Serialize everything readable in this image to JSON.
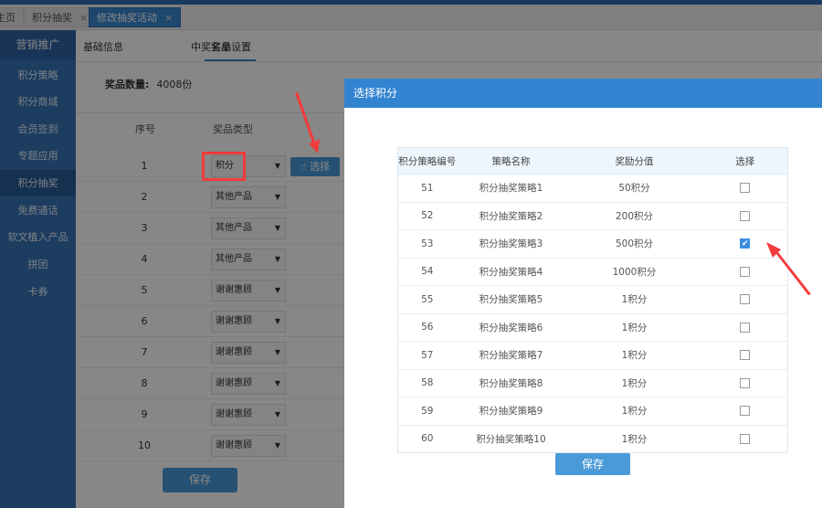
{
  "tabs": [
    {
      "label": "主页",
      "closable": false
    },
    {
      "label": "积分抽奖",
      "closable": true
    },
    {
      "label": "修改抽奖活动",
      "closable": true,
      "active": true
    }
  ],
  "close_glyph": "×",
  "sidebar": {
    "header": "营销推广",
    "items": [
      "积分策略",
      "积分商城",
      "会员签到",
      "专题应用",
      "积分抽奖",
      "免费通话",
      "软文植入产品",
      "拼团",
      "卡券"
    ],
    "active": "积分抽奖"
  },
  "content_tabs": [
    "基础信息",
    "奖品设置",
    "中奖名单"
  ],
  "active_content_tab": "奖品设置",
  "prize_count_label": "奖品数量:",
  "prize_count_value": "4008份",
  "table_headers": [
    "序号",
    "奖品类型"
  ],
  "prize_rows": [
    {
      "no": "1",
      "type": "积分"
    },
    {
      "no": "2",
      "type": "其他产品"
    },
    {
      "no": "3",
      "type": "其他产品"
    },
    {
      "no": "4",
      "type": "其他产品"
    },
    {
      "no": "5",
      "type": "谢谢惠顾"
    },
    {
      "no": "6",
      "type": "谢谢惠顾"
    },
    {
      "no": "7",
      "type": "谢谢惠顾"
    },
    {
      "no": "8",
      "type": "谢谢惠顾"
    },
    {
      "no": "9",
      "type": "谢谢惠顾"
    },
    {
      "no": "10",
      "type": "谢谢惠顾"
    }
  ],
  "choose_button": "选择",
  "save_button": "保存",
  "modal": {
    "title": "选择积分",
    "headers": [
      "积分策略编号",
      "策略名称",
      "奖励分值",
      "选择"
    ],
    "rows": [
      {
        "id": "51",
        "name": "积分抽奖策略1",
        "value": "50积分",
        "checked": false
      },
      {
        "id": "52",
        "name": "积分抽奖策略2",
        "value": "200积分",
        "checked": false
      },
      {
        "id": "53",
        "name": "积分抽奖策略3",
        "value": "500积分",
        "checked": true
      },
      {
        "id": "54",
        "name": "积分抽奖策略4",
        "value": "1000积分",
        "checked": false
      },
      {
        "id": "55",
        "name": "积分抽奖策略5",
        "value": "1积分",
        "checked": false
      },
      {
        "id": "56",
        "name": "积分抽奖策略6",
        "value": "1积分",
        "checked": false
      },
      {
        "id": "57",
        "name": "积分抽奖策略7",
        "value": "1积分",
        "checked": false
      },
      {
        "id": "58",
        "name": "积分抽奖策略8",
        "value": "1积分",
        "checked": false
      },
      {
        "id": "59",
        "name": "积分抽奖策略9",
        "value": "1积分",
        "checked": false
      },
      {
        "id": "60",
        "name": "积分抽奖策略10",
        "value": "1积分",
        "checked": false
      }
    ],
    "save_button": "保存"
  },
  "colors": {
    "primary": "#3384d0",
    "sidebar": "#3873b5",
    "highlight": "#f23b3b"
  }
}
